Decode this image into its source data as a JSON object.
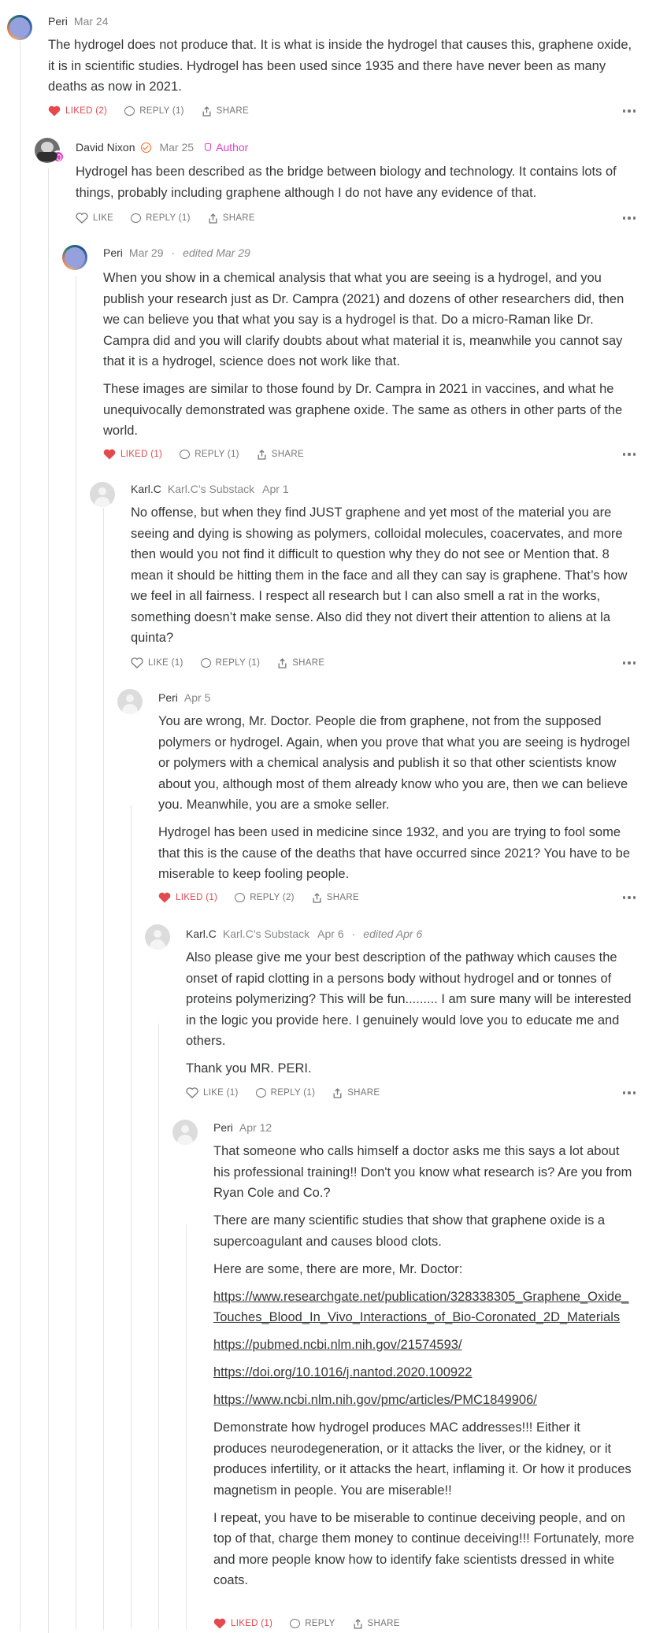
{
  "comments": [
    {
      "name": "Peri",
      "date": "Mar 24",
      "paragraphs": [
        "The hydrogel does not produce that. It is what is inside the hydrogel that causes this, graphene oxide, it is in scientific studies. Hydrogel has been used since 1935 and there have never been as many deaths as now in 2021."
      ],
      "like": "LIKED (2)",
      "reply": "REPLY (1)",
      "share": "SHARE"
    },
    {
      "name": "David Nixon",
      "date": "Mar 25",
      "author": "Author",
      "paragraphs": [
        "Hydrogel has been described as the bridge between biology and technology. It contains lots of things, probably including graphene although I do not have any evidence of that."
      ],
      "like": "LIKE",
      "reply": "REPLY (1)",
      "share": "SHARE"
    },
    {
      "name": "Peri",
      "date": "Mar 29",
      "edited": "edited Mar 29",
      "paragraphs": [
        "When you show in a chemical analysis that what you are seeing is a hydrogel, and you publish your research just as Dr. Campra (2021) and dozens of other researchers did, then we can believe you that what you say is a hydrogel is that. Do a micro-Raman like Dr. Campra did and you will clarify doubts about what material it is, meanwhile you cannot say that it is a hydrogel, science does not work like that.",
        "These images are similar to those found by Dr. Campra in 2021 in vaccines, and what he unequivocally demonstrated was graphene oxide. The same as others in other parts of the world."
      ],
      "like": "LIKED (1)",
      "reply": "REPLY (1)",
      "share": "SHARE"
    },
    {
      "name": "Karl.C",
      "pub": "Karl.C’s Substack",
      "date": "Apr 1",
      "paragraphs": [
        "No offense, but when they find JUST graphene and yet most of the material you are seeing and dying is showing as polymers, colloidal molecules, coacervates, and more then would you not find it difficult to question why they do not see or Mention that. 8 mean it should be hitting them in the face and all they can say is graphene. That’s how we feel in all fairness. I respect all research but I can also smell a rat in the works, something doesn’t make sense. Also did they not divert their attention to aliens at la quinta?"
      ],
      "like": "LIKE (1)",
      "reply": "REPLY (1)",
      "share": "SHARE"
    },
    {
      "name": "Peri",
      "date": "Apr 5",
      "paragraphs": [
        "You are wrong, Mr. Doctor. People die from graphene, not from the supposed polymers or hydrogel. Again, when you prove that what you are seeing is hydrogel or polymers with a chemical analysis and publish it so that other scientists know about you, although most of them already know who you are, then we can believe you. Meanwhile, you are a smoke seller.",
        "Hydrogel has been used in medicine since 1932, and you are trying to fool some that this is the cause of the deaths that have occurred since 2021? You have to be miserable to keep fooling people."
      ],
      "like": "LIKED (1)",
      "reply": "REPLY (2)",
      "share": "SHARE"
    },
    {
      "name": "Karl.C",
      "pub": "Karl.C’s Substack",
      "date": "Apr 6",
      "edited": "edited Apr 6",
      "paragraphs": [
        "Also please give me your best description of the pathway which causes the onset of rapid clotting in a persons body without hydrogel and or tonnes of proteins polymerizing? This will be fun......... I am sure many will be interested in the logic you provide here. I genuinely would love you to educate me and others.",
        "Thank you MR. PERI."
      ],
      "like": "LIKE (1)",
      "reply": "REPLY (1)",
      "share": "SHARE"
    },
    {
      "name": "Peri",
      "date": "Apr 12",
      "paragraphs": [
        "That someone who calls himself a doctor asks me this says a lot about his professional training!! Don't you know what research is? Are you from Ryan Cole and Co.?",
        "There are many scientific studies that show that graphene oxide is a supercoagulant and causes blood clots.",
        "Here are some, there are more, Mr. Doctor:"
      ],
      "links": [
        "https://www.researchgate.net/publication/328338305_Graphene_Oxide_Touches_Blood_In_Vivo_Interactions_of_Bio-Coronated_2D_Materials",
        "https://pubmed.ncbi.nlm.nih.gov/21574593/",
        "https://doi.org/10.1016/j.nantod.2020.100922",
        "https://www.ncbi.nlm.nih.gov/pmc/articles/PMC1849906/"
      ],
      "paragraphs_after": [
        "Demonstrate how hydrogel produces MAC addresses!!! Either it produces neurodegeneration, or it attacks the liver, or the kidney, or it produces infertility, or it attacks the heart, inflaming it. Or how it produces magnetism in people. You are miserable!!",
        "I repeat, you have to be miserable to continue deceiving people, and on top of that, charge them money to continue deceiving!!! Fortunately, more and more people know how to identify fake scientists dressed in white coats."
      ],
      "like": "LIKED (1)",
      "reply": "REPLY",
      "share": "SHARE"
    }
  ],
  "colors": {
    "liked": "#e5484d",
    "author": "#e042c8",
    "verified": "#ff6719",
    "thread": "#e3e3e3"
  }
}
